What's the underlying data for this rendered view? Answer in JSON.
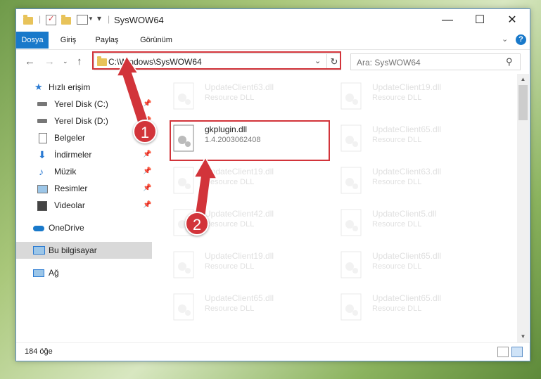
{
  "window": {
    "title": "SysWOW64"
  },
  "ribbon": {
    "tabs": [
      "Dosya",
      "Giriş",
      "Paylaş",
      "Görünüm"
    ]
  },
  "address": {
    "path": "C:\\Windows\\SysWOW64",
    "search_placeholder": "Ara: SysWOW64"
  },
  "nav": {
    "items": [
      {
        "label": "Hızlı erişim",
        "icon": "star-icon",
        "pinned": false
      },
      {
        "label": "Yerel Disk (C:)",
        "icon": "drive-icon",
        "pinned": true
      },
      {
        "label": "Yerel Disk (D:)",
        "icon": "drive-icon",
        "pinned": true
      },
      {
        "label": "Belgeler",
        "icon": "document-icon",
        "pinned": true
      },
      {
        "label": "İndirmeler",
        "icon": "download-icon",
        "pinned": true
      },
      {
        "label": "Müzik",
        "icon": "music-icon",
        "pinned": true
      },
      {
        "label": "Resimler",
        "icon": "pictures-icon",
        "pinned": true
      },
      {
        "label": "Videolar",
        "icon": "video-icon",
        "pinned": true
      },
      {
        "label": "OneDrive",
        "icon": "cloud-icon",
        "pinned": false
      },
      {
        "label": "Bu bilgisayar",
        "icon": "computer-icon",
        "pinned": false
      },
      {
        "label": "Ağ",
        "icon": "network-icon",
        "pinned": false
      }
    ]
  },
  "files": {
    "left": [
      {
        "name": "UpdateClient63.dll",
        "desc": "Resource DLL"
      },
      {
        "name": "gkplugin.dll",
        "desc": "1.4.2003062408"
      },
      {
        "name": "UpdateClient19.dll",
        "desc": "Resource DLL"
      },
      {
        "name": "UpdateClient42.dll",
        "desc": "Resource DLL"
      },
      {
        "name": "UpdateClient19.dll",
        "desc": "Resource DLL"
      },
      {
        "name": "UpdateClient65.dll",
        "desc": "Resource DLL"
      }
    ],
    "right": [
      {
        "name": "UpdateClient19.dll",
        "desc": "Resource DLL"
      },
      {
        "name": "UpdateClient65.dll",
        "desc": "Resource DLL"
      },
      {
        "name": "UpdateClient63.dll",
        "desc": "Resource DLL"
      },
      {
        "name": "UpdateClient5.dll",
        "desc": "Resource DLL"
      },
      {
        "name": "UpdateClient65.dll",
        "desc": "Resource DLL"
      },
      {
        "name": "UpdateClient65.dll",
        "desc": "Resource DLL"
      }
    ]
  },
  "status": {
    "count": "184 öğe"
  },
  "annotations": {
    "step1": "1",
    "step2": "2"
  },
  "colors": {
    "accent": "#1979ca",
    "highlight": "#d2343a"
  }
}
